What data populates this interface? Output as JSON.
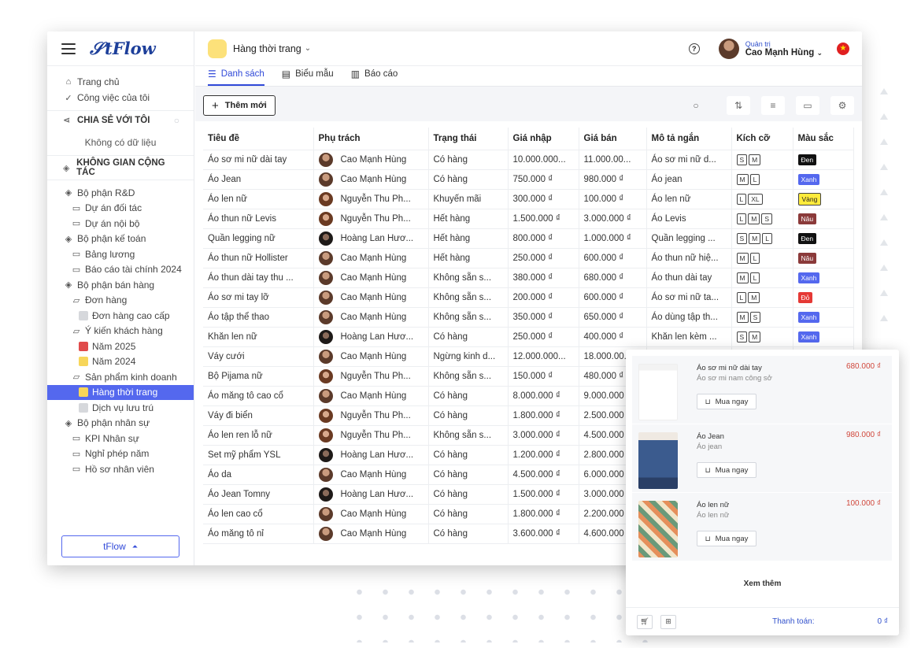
{
  "app": {
    "logo": "tFlow"
  },
  "sidebar": {
    "home": "Trang chủ",
    "my_tasks": "Công việc của tôi",
    "shared_title": "CHIA SẺ VỚI TÔI",
    "shared_empty": "Không có dữ liệu",
    "workspace_title": "KHÔNG GIAN CỘNG TÁC",
    "tree": [
      {
        "label": "Bộ phận R&D",
        "level": 0,
        "icon": "group-icon"
      },
      {
        "label": "Dự án đối tác",
        "level": 1,
        "icon": "folder-icon"
      },
      {
        "label": "Dự án nội bộ",
        "level": 1,
        "icon": "folder-icon"
      },
      {
        "label": "Bộ phận kế toán",
        "level": 0,
        "icon": "group-icon"
      },
      {
        "label": "Bảng lương",
        "level": 1,
        "icon": "folder-icon"
      },
      {
        "label": "Báo cáo tài chính 2024",
        "level": 1,
        "icon": "folder-icon"
      },
      {
        "label": "Bộ phận bán hàng",
        "level": 0,
        "icon": "group-icon"
      },
      {
        "label": "Đơn hàng",
        "level": 1,
        "icon": "folder-open-icon"
      },
      {
        "label": "Đơn hàng cao cấp",
        "level": 2,
        "icon": "square",
        "color": "#d6d8dc"
      },
      {
        "label": "Ý kiến khách hàng",
        "level": 1,
        "icon": "folder-open-icon"
      },
      {
        "label": "Năm 2025",
        "level": 2,
        "icon": "square",
        "color": "#e04b4b"
      },
      {
        "label": "Năm 2024",
        "level": 2,
        "icon": "square",
        "color": "#f7d65a"
      },
      {
        "label": "Sản phẩm kinh doanh",
        "level": 1,
        "icon": "folder-open-icon"
      },
      {
        "label": "Hàng thời trang",
        "level": 2,
        "icon": "square",
        "color": "#f7d65a",
        "active": true
      },
      {
        "label": "Dịch vụ lưu trú",
        "level": 2,
        "icon": "square",
        "color": "#d6d8dc"
      },
      {
        "label": "Bộ phận nhân sự",
        "level": 0,
        "icon": "group-icon"
      },
      {
        "label": "KPI Nhân sự",
        "level": 1,
        "icon": "folder-icon"
      },
      {
        "label": "Nghỉ phép năm",
        "level": 1,
        "icon": "folder-icon"
      },
      {
        "label": "Hồ sơ nhân viên",
        "level": 1,
        "icon": "folder-icon"
      }
    ],
    "footer_button": "tFlow"
  },
  "header": {
    "workspace": "Hàng thời trang",
    "user_role": "Quản trị",
    "user_name": "Cao Mạnh Hùng"
  },
  "tabs": [
    {
      "label": "Danh sách",
      "icon": "list-icon",
      "active": true
    },
    {
      "label": "Biểu mẫu",
      "icon": "form-icon"
    },
    {
      "label": "Báo cáo",
      "icon": "report-icon"
    }
  ],
  "toolbar": {
    "add_label": "Thêm mới"
  },
  "table": {
    "columns": [
      "Tiêu đề",
      "Phụ trách",
      "Trạng thái",
      "Giá nhập",
      "Giá bán",
      "Mô tả ngắn",
      "Kích cỡ",
      "Màu sắc"
    ],
    "rows": [
      {
        "title": "Áo sơ mi nữ dài tay",
        "owner": "Cao Mạnh Hùng",
        "av": "m",
        "status": "Có hàng",
        "cost": "10.000.000...",
        "price": "11.000.00...",
        "desc": "Áo sơ mi nữ d...",
        "sizes": [
          "S",
          "M"
        ],
        "color": "Đen",
        "cbg": "#111111",
        "cfg": "#ffffff"
      },
      {
        "title": "Áo Jean",
        "owner": "Cao Mạnh Hùng",
        "av": "m",
        "status": "Có hàng",
        "cost": "750.000 ₫",
        "price": "980.000 ₫",
        "desc": "Áo jean",
        "sizes": [
          "M",
          "L"
        ],
        "color": "Xanh",
        "cbg": "#5468ee",
        "cfg": "#ffffff"
      },
      {
        "title": "Áo len nữ",
        "owner": "Nguyễn Thu Ph...",
        "av": "f",
        "status": "Khuyến mãi",
        "cost": "300.000 ₫",
        "price": "100.000 ₫",
        "desc": "Áo len nữ",
        "sizes": [
          "L",
          "XL"
        ],
        "color": "Vàng",
        "cbg": "#ffeb3b",
        "cfg": "#222222"
      },
      {
        "title": "Áo thun nữ Levis",
        "owner": "Nguyễn Thu Ph...",
        "av": "f",
        "status": "Hết hàng",
        "cost": "1.500.000 ₫",
        "price": "3.000.000 ₫",
        "desc": "Áo Levis",
        "sizes": [
          "L",
          "M",
          "S"
        ],
        "color": "Nâu",
        "cbg": "#8b3a3a",
        "cfg": "#ffffff"
      },
      {
        "title": "Quần legging nữ",
        "owner": "Hoàng Lan Hươ...",
        "av": "d",
        "status": "Hết hàng",
        "cost": "800.000 ₫",
        "price": "1.000.000 ₫",
        "desc": "Quần legging ...",
        "sizes": [
          "S",
          "M",
          "L"
        ],
        "color": "Đen",
        "cbg": "#111111",
        "cfg": "#ffffff"
      },
      {
        "title": "Áo thun nữ Hollister",
        "owner": "Cao Mạnh Hùng",
        "av": "m",
        "status": "Hết hàng",
        "cost": "250.000 ₫",
        "price": "600.000 ₫",
        "desc": "Áo thun nữ hiệ...",
        "sizes": [
          "M",
          "L"
        ],
        "color": "Nâu",
        "cbg": "#8b3a3a",
        "cfg": "#ffffff"
      },
      {
        "title": "Áo thun dài tay thu ...",
        "owner": "Cao Mạnh Hùng",
        "av": "m",
        "status": "Không sẵn s...",
        "cost": "380.000 ₫",
        "price": "680.000 ₫",
        "desc": "Áo thun dài tay",
        "sizes": [
          "M",
          "L"
        ],
        "color": "Xanh",
        "cbg": "#5468ee",
        "cfg": "#ffffff"
      },
      {
        "title": "Áo sơ mi tay lỡ",
        "owner": "Cao Mạnh Hùng",
        "av": "m",
        "status": "Không sẵn s...",
        "cost": "200.000 ₫",
        "price": "600.000 ₫",
        "desc": "Áo sơ mi nữ ta...",
        "sizes": [
          "L",
          "M"
        ],
        "color": "Đỏ",
        "cbg": "#e53935",
        "cfg": "#ffffff"
      },
      {
        "title": "Áo tập thể thao",
        "owner": "Cao Mạnh Hùng",
        "av": "m",
        "status": "Không sẵn s...",
        "cost": "350.000 ₫",
        "price": "650.000 ₫",
        "desc": "Áo dùng tập th...",
        "sizes": [
          "M",
          "S"
        ],
        "color": "Xanh",
        "cbg": "#5468ee",
        "cfg": "#ffffff"
      },
      {
        "title": "Khăn len nữ",
        "owner": "Hoàng Lan Hươ...",
        "av": "d",
        "status": "Có hàng",
        "cost": "250.000 ₫",
        "price": "400.000 ₫",
        "desc": "Khăn len kèm ...",
        "sizes": [
          "S",
          "M"
        ],
        "color": "Xanh",
        "cbg": "#5468ee",
        "cfg": "#ffffff"
      },
      {
        "title": "Váy cưới",
        "owner": "Cao Mạnh Hùng",
        "av": "m",
        "status": "Ngừng kinh d...",
        "cost": "12.000.000...",
        "price": "18.000.00...",
        "desc": "",
        "sizes": [],
        "color": "",
        "cbg": "",
        "cfg": ""
      },
      {
        "title": "Bộ Pijama nữ",
        "owner": "Nguyễn Thu Ph...",
        "av": "f",
        "status": "Không sẵn s...",
        "cost": "150.000 ₫",
        "price": "480.000 ₫",
        "desc": "",
        "sizes": [],
        "color": "",
        "cbg": "",
        "cfg": ""
      },
      {
        "title": "Áo măng tô cao cổ",
        "owner": "Cao Mạnh Hùng",
        "av": "m",
        "status": "Có hàng",
        "cost": "8.000.000 ₫",
        "price": "9.000.000 ₫",
        "desc": "",
        "sizes": [],
        "color": "",
        "cbg": "",
        "cfg": ""
      },
      {
        "title": "Váy đi biển",
        "owner": "Nguyễn Thu Ph...",
        "av": "f",
        "status": "Có hàng",
        "cost": "1.800.000 ₫",
        "price": "2.500.000 ₫",
        "desc": "",
        "sizes": [],
        "color": "",
        "cbg": "",
        "cfg": ""
      },
      {
        "title": "Áo len ren lỗ nữ",
        "owner": "Nguyễn Thu Ph...",
        "av": "f",
        "status": "Không sẵn s...",
        "cost": "3.000.000 ₫",
        "price": "4.500.000 ₫",
        "desc": "",
        "sizes": [],
        "color": "",
        "cbg": "",
        "cfg": ""
      },
      {
        "title": "Set mỹ phẩm YSL",
        "owner": "Hoàng Lan Hươ...",
        "av": "d",
        "status": "Có hàng",
        "cost": "1.200.000 ₫",
        "price": "2.800.000 ₫",
        "desc": "",
        "sizes": [],
        "color": "",
        "cbg": "",
        "cfg": ""
      },
      {
        "title": "Áo da",
        "owner": "Cao Mạnh Hùng",
        "av": "m",
        "status": "Có hàng",
        "cost": "4.500.000 ₫",
        "price": "6.000.000 ₫",
        "desc": "",
        "sizes": [],
        "color": "",
        "cbg": "",
        "cfg": ""
      },
      {
        "title": "Áo Jean Tomny",
        "owner": "Hoàng Lan Hươ...",
        "av": "d",
        "status": "Có hàng",
        "cost": "1.500.000 ₫",
        "price": "3.000.000 ₫",
        "desc": "",
        "sizes": [],
        "color": "",
        "cbg": "",
        "cfg": ""
      },
      {
        "title": "Áo len cao cổ",
        "owner": "Cao Mạnh Hùng",
        "av": "m",
        "status": "Có hàng",
        "cost": "1.800.000 ₫",
        "price": "2.200.000 ₫",
        "desc": "",
        "sizes": [],
        "color": "",
        "cbg": "",
        "cfg": ""
      },
      {
        "title": "Áo măng tô nỉ",
        "owner": "Cao Mạnh Hùng",
        "av": "m",
        "status": "Có hàng",
        "cost": "3.600.000 ₫",
        "price": "4.600.000 ₫",
        "desc": "",
        "sizes": [],
        "color": "",
        "cbg": "",
        "cfg": ""
      }
    ]
  },
  "cart": {
    "items": [
      {
        "name": "Áo sơ mi nữ dài tay",
        "desc": "Áo sơ mi nam công sở",
        "price": "680.000 ₫",
        "img": "white-shirt"
      },
      {
        "name": "Áo Jean",
        "desc": "Áo jean",
        "price": "980.000 ₫",
        "img": "denim-jacket"
      },
      {
        "name": "Áo len nữ",
        "desc": "Áo len nữ",
        "price": "100.000 ₫",
        "img": "knit-sweater"
      }
    ],
    "buy_label": "Mua ngay",
    "see_more": "Xem thêm",
    "checkout_label": "Thanh toán:",
    "checkout_total": "0 ₫"
  }
}
